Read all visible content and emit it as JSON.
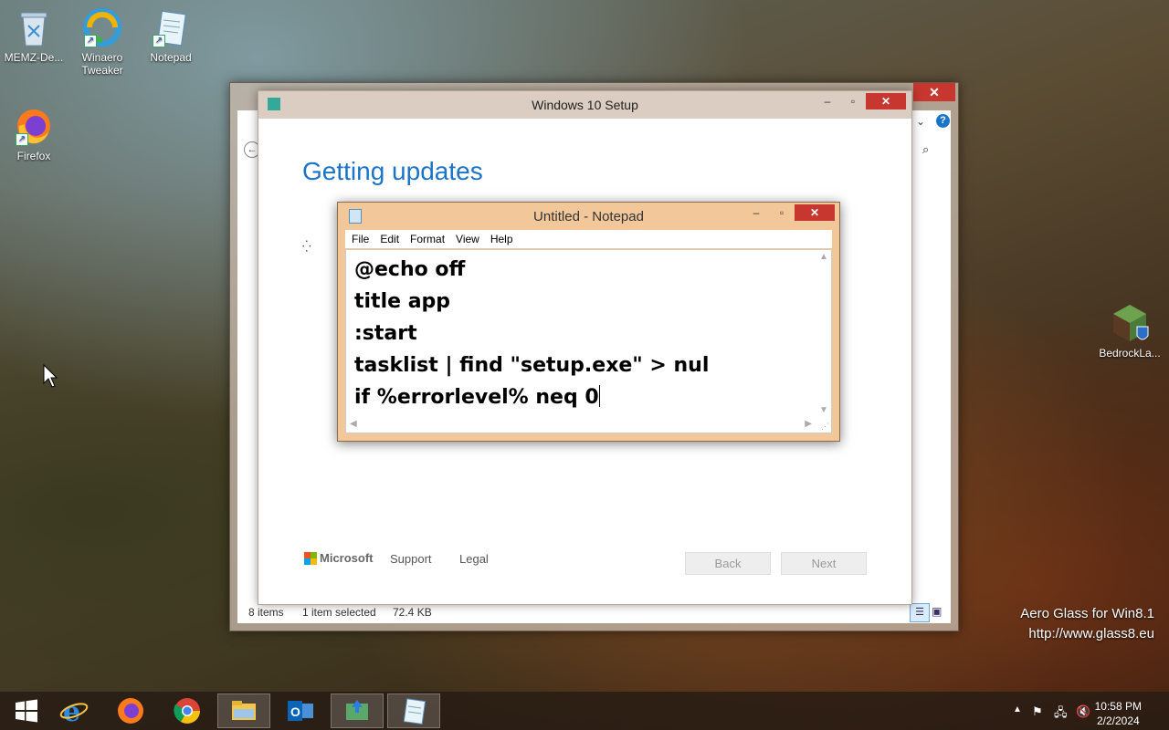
{
  "desktop": {
    "icons": [
      {
        "label": "MEMZ-De...",
        "icon": "recycle-bin-icon"
      },
      {
        "label": "Winaero Tweaker",
        "icon": "winaero-icon"
      },
      {
        "label": "Notepad",
        "icon": "notepad-icon"
      },
      {
        "label": "Firefox",
        "icon": "firefox-icon"
      },
      {
        "label": "BedrockLa...",
        "icon": "minecraft-icon"
      }
    ],
    "watermark": {
      "line1": "Aero Glass for Win8.1",
      "line2": "http://www.glass8.eu"
    }
  },
  "explorer": {
    "status_items": "8 items",
    "status_selected": "1 item selected",
    "status_size": "72.4 KB"
  },
  "setup": {
    "title": "Windows 10 Setup",
    "heading": "Getting updates",
    "brand": "Microsoft",
    "support": "Support",
    "legal": "Legal",
    "back": "Back",
    "next": "Next"
  },
  "notepad": {
    "title": "Untitled - Notepad",
    "menu": [
      "File",
      "Edit",
      "Format",
      "View",
      "Help"
    ],
    "lines": [
      "@echo off",
      "title app",
      ":start",
      "tasklist | find \"setup.exe\" > nul",
      "if %errorlevel% neq 0"
    ]
  },
  "taskbar": {
    "time": "10:58 PM",
    "date": "2/2/2024",
    "apps": [
      "start-icon",
      "internet-explorer-icon",
      "firefox-icon",
      "chrome-icon",
      "file-explorer-icon",
      "outlook-icon",
      "setup-icon",
      "notepad-icon"
    ]
  },
  "colors": {
    "accent": "#1a74c9",
    "close": "#c7372f",
    "notepad_frame": "#f2c79a"
  }
}
